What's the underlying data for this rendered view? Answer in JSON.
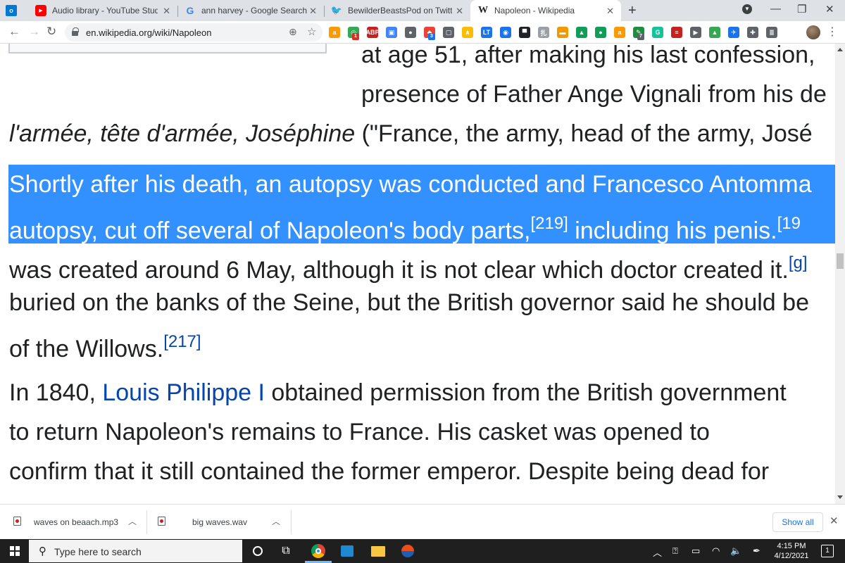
{
  "tabs": [
    {
      "title": "Audio library - YouTube Studio",
      "favicon": "youtube-icon"
    },
    {
      "title": "ann harvey - Google Search",
      "favicon": "google-icon"
    },
    {
      "title": "BewilderBeastsPod on Twitter: \"R",
      "favicon": "twitter-icon"
    },
    {
      "title": "Napoleon - Wikipedia",
      "favicon": "wikipedia-icon",
      "active": true
    }
  ],
  "toolbar": {
    "url": "en.wikipedia.org/wiki/Napoleon"
  },
  "extensions": [
    {
      "label": "a",
      "color": "#ff9900",
      "badge": ""
    },
    {
      "label": "◎",
      "color": "#34a853",
      "badge": "1",
      "badge_color": "#d93025"
    },
    {
      "label": "ABP",
      "color": "#c5221f",
      "badge": ""
    },
    {
      "label": "▣",
      "color": "#4285f4",
      "badge": ""
    },
    {
      "label": "●",
      "color": "#5f6368",
      "badge": ""
    },
    {
      "label": "◆",
      "color": "#ea4335",
      "badge": "3",
      "badge_color": "#1a73e8"
    },
    {
      "label": "▢",
      "color": "#5f6368",
      "badge": ""
    },
    {
      "label": "∧",
      "color": "#fbbc04",
      "badge": ""
    },
    {
      "label": "LT",
      "color": "#1a73e8",
      "badge": ""
    },
    {
      "label": "◉",
      "color": "#1a73e8",
      "badge": ""
    },
    {
      "label": "▀",
      "color": "#202124",
      "badge": ""
    },
    {
      "label": "扎",
      "color": "#9aa0a6",
      "badge": ""
    },
    {
      "label": "▬",
      "color": "#f29900",
      "badge": ""
    },
    {
      "label": "▲",
      "color": "#0f9d58",
      "badge": ""
    },
    {
      "label": "●",
      "color": "#0f9d58",
      "badge": ""
    },
    {
      "label": "a",
      "color": "#ff9900",
      "badge": ""
    },
    {
      "label": "✎",
      "color": "#1e8e3e",
      "badge": "7",
      "badge_color": "#5f6368"
    },
    {
      "label": "G",
      "color": "#15c39a",
      "badge": ""
    },
    {
      "label": "≡",
      "color": "#c5221f",
      "badge": ""
    },
    {
      "label": "▶",
      "color": "#5f6368",
      "badge": ""
    },
    {
      "label": "▲",
      "color": "#34a853",
      "badge": ""
    },
    {
      "label": "✈",
      "color": "#1a73e8",
      "badge": ""
    },
    {
      "label": "✚",
      "color": "#5f6368",
      "badge": ""
    },
    {
      "label": "≣",
      "color": "#5f6368",
      "badge": ""
    }
  ],
  "article": {
    "line1": "at age 51, after making his last confession,",
    "line2": "presence of Father Ange Vignali from his de",
    "line3_italic": "l'armée, tête d'armée, Joséphine",
    "line3_rest": " (\"France, the army, head of the army, José",
    "line4_a": "Shortly after his death, an autopsy was conducted and ",
    "line4_link": "Francesco Antomma",
    "line5_a": "autopsy, cut off several of Napoleon's body parts,",
    "line5_ref1": "[219]",
    "line5_b": " including his penis.",
    "line5_ref2": "[19",
    "line6_a": "was created around 6 May, although it is not clear which doctor created it.",
    "line6_ref": "[g]",
    "line7": "buried on the banks of the Seine, but the British governor said he should be",
    "line8_a": "of the Willows.",
    "line8_ref": "[217]",
    "para2_a": "In 1840, ",
    "para2_link": "Louis Philippe I",
    "para2_b": " obtained permission from the British government",
    "para2_line2": "to return Napoleon's remains to France. His casket was opened to",
    "para2_line3": "confirm that it still contained the former emperor. Despite being dead for"
  },
  "downloads": {
    "items": [
      {
        "name": "waves on beaach.mp3"
      },
      {
        "name": "big waves.wav"
      }
    ],
    "show_all": "Show all"
  },
  "taskbar": {
    "search_placeholder": "Type here to search",
    "time": "4:15 PM",
    "date": "4/12/2021",
    "notification_count": "1"
  }
}
